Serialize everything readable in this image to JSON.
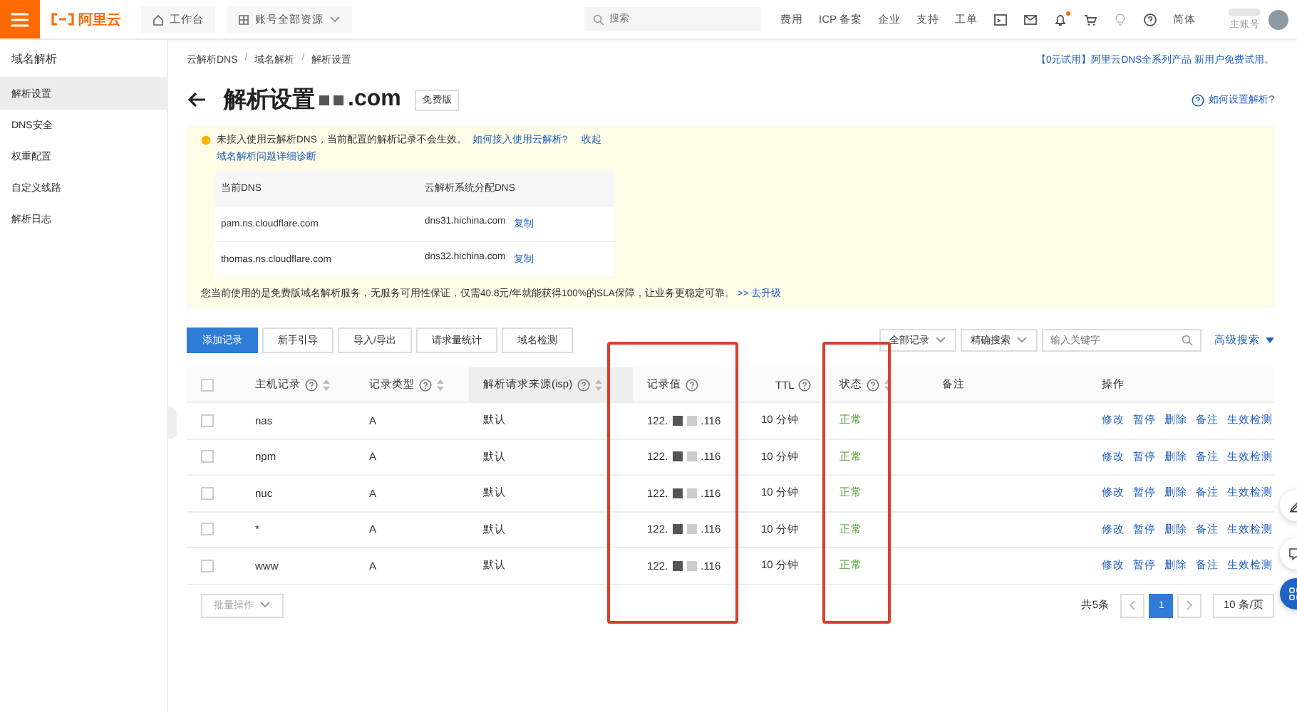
{
  "topbar": {
    "logo": "阿里云",
    "workbench": "工作台",
    "resources": "账号全部资源",
    "search_placeholder": "搜索",
    "links": [
      "费用",
      "ICP 备案",
      "企业",
      "支持",
      "工单"
    ],
    "language": "简体",
    "account_label": "主账号",
    "notification_dot": true
  },
  "sidebar": {
    "title": "域名解析",
    "items": [
      {
        "label": "解析设置",
        "selected": true
      },
      {
        "label": "DNS安全",
        "selected": false
      },
      {
        "label": "权重配置",
        "selected": false
      },
      {
        "label": "自定义线路",
        "selected": false
      },
      {
        "label": "解析日志",
        "selected": false
      }
    ]
  },
  "breadcrumb": [
    "云解析DNS",
    "域名解析",
    "解析设置"
  ],
  "breadcrumb_separator": "/",
  "promo": "【0元试用】阿里云DNS全系列产品 新用户免费试用。",
  "page_title": "解析设置",
  "domain_suffix": ".com",
  "edition_badge": "免费版",
  "help_link": "如何设置解析?",
  "notice": {
    "message": "未接入使用云解析DNS，当前配置的解析记录不会生效。",
    "link": "如何接入使用云解析?",
    "collapse": "收起",
    "diagnose": "域名解析问题详细诊断",
    "dns_columns": [
      "当前DNS",
      "云解析系统分配DNS"
    ],
    "dns_rows": [
      {
        "current": "pam.ns.cloudflare.com",
        "assigned": "dns31.hichina.com",
        "action": "复制"
      },
      {
        "current": "thomas.ns.cloudflare.com",
        "assigned": "dns32.hichina.com",
        "action": "复制"
      }
    ],
    "upgrade_text": "您当前使用的是免费版域名解析服务，无服务可用性保证，仅需40.8元/年就能获得100%的SLA保障，让业务更稳定可靠。",
    "upgrade_link": ">> 去升级"
  },
  "toolbar": {
    "buttons": [
      {
        "label": "添加记录",
        "primary": true
      },
      {
        "label": "新手引导",
        "primary": false
      },
      {
        "label": "导入/导出",
        "primary": false
      },
      {
        "label": "请求量统计",
        "primary": false
      },
      {
        "label": "域名检测",
        "primary": false
      }
    ],
    "filter": "全部记录",
    "search_mode": "精确搜索",
    "search_placeholder": "输入关键字",
    "advanced": "高级搜索"
  },
  "table": {
    "select_all_checked": false,
    "columns": [
      {
        "label": "主机记录",
        "help": true,
        "sortable": true,
        "active": false,
        "highlighted": false
      },
      {
        "label": "记录类型",
        "help": true,
        "sortable": true,
        "active": false,
        "highlighted": false
      },
      {
        "label": "解析请求来源(isp)",
        "help": true,
        "sortable": true,
        "active": true,
        "highlighted": false
      },
      {
        "label": "记录值",
        "help": true,
        "sortable": false,
        "active": false,
        "highlighted": true
      },
      {
        "label": "TTL",
        "help": true,
        "sortable": false,
        "active": false,
        "highlighted": false
      },
      {
        "label": "状态",
        "help": true,
        "sortable": true,
        "active": false,
        "highlighted": true
      },
      {
        "label": "备注",
        "help": false,
        "sortable": false,
        "active": false,
        "highlighted": false
      },
      {
        "label": "操作",
        "help": false,
        "sortable": false,
        "active": false,
        "highlighted": false
      }
    ],
    "rows": [
      {
        "checked": false,
        "host": "nas",
        "type": "A",
        "line": "默认",
        "value_start": "122.",
        "value_end": ".116",
        "ttl": "10 分钟",
        "status": "正常",
        "actions": [
          "修改",
          "暂停",
          "删除",
          "备注",
          "生效检测"
        ]
      },
      {
        "checked": false,
        "host": "npm",
        "type": "A",
        "line": "默认",
        "value_start": "122.",
        "value_end": ".116",
        "ttl": "10 分钟",
        "status": "正常",
        "actions": [
          "修改",
          "暂停",
          "删除",
          "备注",
          "生效检测"
        ]
      },
      {
        "checked": false,
        "host": "nuc",
        "type": "A",
        "line": "默认",
        "value_start": "122.",
        "value_end": ".116",
        "ttl": "10 分钟",
        "status": "正常",
        "actions": [
          "修改",
          "暂停",
          "删除",
          "备注",
          "生效检测"
        ]
      },
      {
        "checked": false,
        "host": "*",
        "type": "A",
        "line": "默认",
        "value_start": "122.",
        "value_end": ".116",
        "ttl": "10 分钟",
        "status": "正常",
        "actions": [
          "修改",
          "暂停",
          "删除",
          "备注",
          "生效检测"
        ]
      },
      {
        "checked": false,
        "host": "www",
        "type": "A",
        "line": "默认",
        "value_start": "122.",
        "value_end": ".116",
        "ttl": "10 分钟",
        "status": "正常",
        "actions": [
          "修改",
          "暂停",
          "删除",
          "备注",
          "生效检测"
        ]
      }
    ]
  },
  "batch_button": "批量操作",
  "pagination": {
    "total": "共5条",
    "pages": [
      {
        "label": "1",
        "selected": true
      }
    ],
    "page_size": "10 条/页"
  }
}
